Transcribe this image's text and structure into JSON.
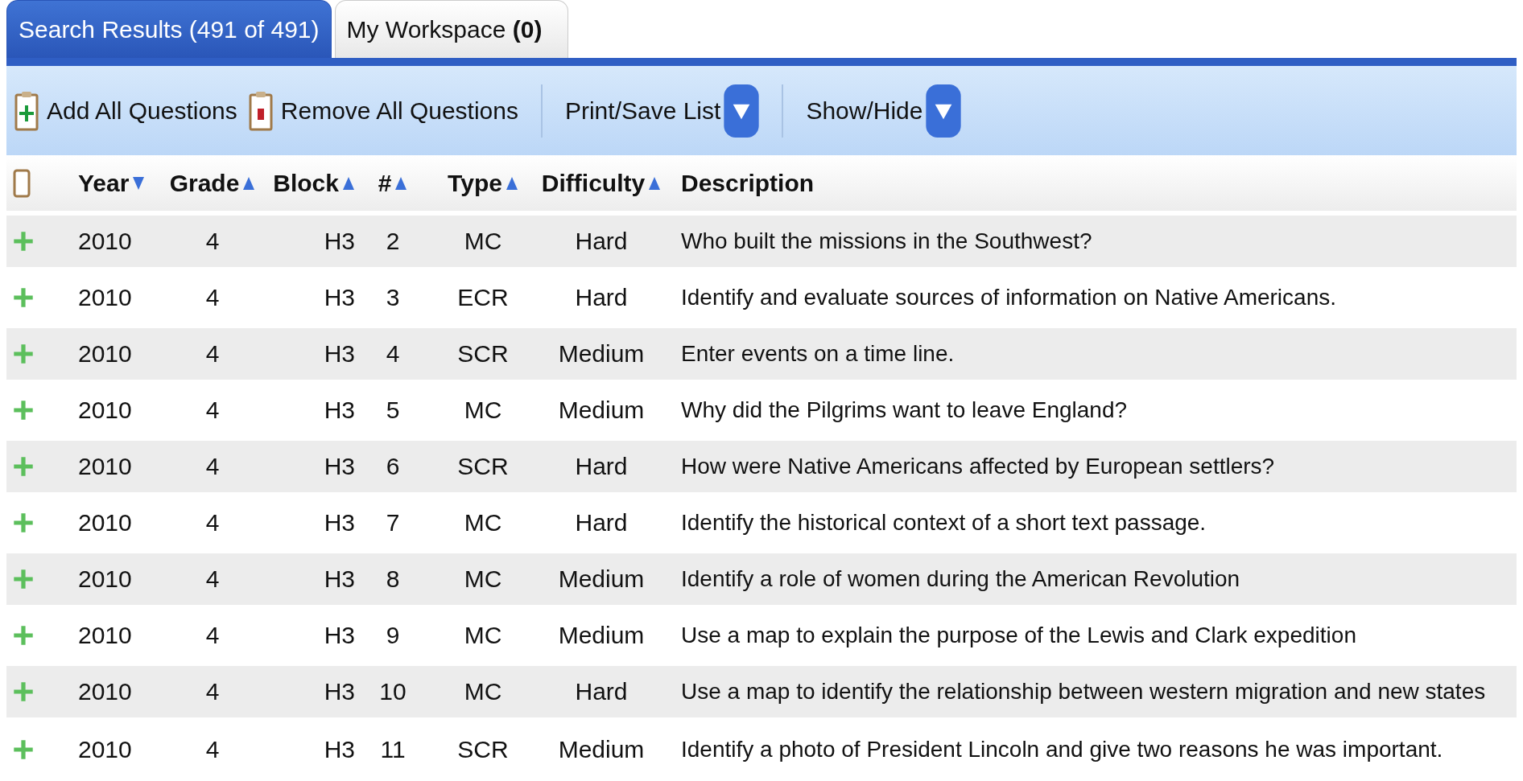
{
  "tabs": [
    {
      "label": "Search Results (491 of 491)",
      "selected": true
    },
    {
      "label": "My Workspace **(0)**",
      "selected": false
    }
  ],
  "toolbar": [
    {
      "kind": "add",
      "label": "Add All Questions"
    },
    {
      "kind": "remove",
      "label": "Remove All Questions"
    },
    {
      "kind": "dropdown",
      "label": "Print/Save List"
    },
    {
      "kind": "dropdown",
      "label": "Show/Hide"
    }
  ],
  "table": {
    "select_all": {
      "checked": false
    },
    "columns": [
      {
        "label": "Year",
        "descending": true
      },
      {
        "label": "Grade",
        "descending": false
      },
      {
        "label": "Block",
        "descending": false
      },
      {
        "label": "#",
        "descending": false
      },
      {
        "label": "Type",
        "descending": false
      },
      {
        "label": "Difficulty",
        "descending": false
      },
      {
        "label": "Description"
      }
    ],
    "rows": [
      [
        "2010",
        "4",
        "H3",
        "2",
        "MC",
        "Hard",
        "Who built the missions in the Southwest?"
      ],
      [
        "2010",
        "4",
        "H3",
        "3",
        "ECR",
        "Hard",
        "Identify and evaluate sources of information on Native Americans."
      ],
      [
        "2010",
        "4",
        "H3",
        "4",
        "SCR",
        "Medium",
        "Enter events on a time line."
      ],
      [
        "2010",
        "4",
        "H3",
        "5",
        "MC",
        "Medium",
        "Why did the Pilgrims want to leave England?"
      ],
      [
        "2010",
        "4",
        "H3",
        "6",
        "SCR",
        "Hard",
        "How were Native Americans affected by European settlers?"
      ],
      [
        "2010",
        "4",
        "H3",
        "7",
        "MC",
        "Hard",
        "Identify the historical context of a short text passage."
      ],
      [
        "2010",
        "4",
        "H3",
        "8",
        "MC",
        "Medium",
        "Identify a role of women during the American Revolution"
      ],
      [
        "2010",
        "4",
        "H3",
        "9",
        "MC",
        "Medium",
        "Use a map to explain the purpose of the Lewis and Clark expedition"
      ],
      [
        "2010",
        "4",
        "H3",
        "10",
        "MC",
        "Hard",
        "Use a map to identify the relationship between western migration and new states"
      ],
      [
        "2010",
        "4",
        "H3",
        "11",
        "SCR",
        "Medium",
        "Identify a photo of President Lincoln and give two reasons he was important."
      ]
    ]
  }
}
